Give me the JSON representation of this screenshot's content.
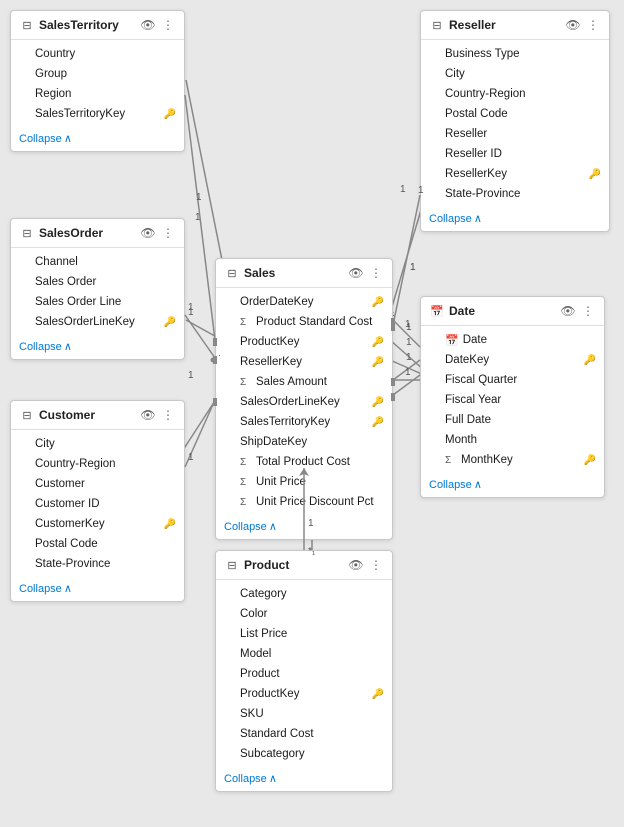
{
  "tables": {
    "salesTerritory": {
      "title": "SalesTerritory",
      "icon": "🗓",
      "fields": [
        {
          "name": "Country",
          "prefix": ""
        },
        {
          "name": "Group",
          "prefix": ""
        },
        {
          "name": "Region",
          "prefix": ""
        },
        {
          "name": "SalesTerritoryKey",
          "prefix": "",
          "key": true
        }
      ],
      "collapse": "Collapse"
    },
    "salesOrder": {
      "title": "SalesOrder",
      "icon": "🗓",
      "fields": [
        {
          "name": "Channel",
          "prefix": ""
        },
        {
          "name": "Sales Order",
          "prefix": ""
        },
        {
          "name": "Sales Order Line",
          "prefix": ""
        },
        {
          "name": "SalesOrderLineKey",
          "prefix": "",
          "key": true
        }
      ],
      "collapse": "Collapse"
    },
    "customer": {
      "title": "Customer",
      "icon": "🗓",
      "fields": [
        {
          "name": "City",
          "prefix": ""
        },
        {
          "name": "Country-Region",
          "prefix": ""
        },
        {
          "name": "Customer",
          "prefix": ""
        },
        {
          "name": "Customer ID",
          "prefix": ""
        },
        {
          "name": "CustomerKey",
          "prefix": "",
          "key": true
        },
        {
          "name": "Postal Code",
          "prefix": ""
        },
        {
          "name": "State-Province",
          "prefix": ""
        }
      ],
      "collapse": "Collapse"
    },
    "sales": {
      "title": "Sales",
      "icon": "🗓",
      "fields": [
        {
          "name": "OrderDateKey",
          "prefix": "",
          "key": true
        },
        {
          "name": "Product Standard Cost",
          "prefix": "Σ"
        },
        {
          "name": "ProductKey",
          "prefix": "",
          "key": true
        },
        {
          "name": "ResellerKey",
          "prefix": "",
          "key": true
        },
        {
          "name": "Sales Amount",
          "prefix": "Σ"
        },
        {
          "name": "SalesOrderLineKey",
          "prefix": "",
          "key": true
        },
        {
          "name": "SalesTerritoryKey",
          "prefix": "",
          "key": true
        },
        {
          "name": "ShipDateKey",
          "prefix": ""
        },
        {
          "name": "Total Product Cost",
          "prefix": "Σ"
        },
        {
          "name": "Unit Price",
          "prefix": "Σ"
        },
        {
          "name": "Unit Price Discount Pct",
          "prefix": "Σ"
        }
      ],
      "collapse": "Collapse"
    },
    "reseller": {
      "title": "Reseller",
      "icon": "🗓",
      "fields": [
        {
          "name": "Business Type",
          "prefix": ""
        },
        {
          "name": "City",
          "prefix": ""
        },
        {
          "name": "Country-Region",
          "prefix": ""
        },
        {
          "name": "Postal Code",
          "prefix": ""
        },
        {
          "name": "Reseller",
          "prefix": ""
        },
        {
          "name": "Reseller ID",
          "prefix": ""
        },
        {
          "name": "ResellerKey",
          "prefix": "",
          "key": true
        },
        {
          "name": "State-Province",
          "prefix": ""
        }
      ],
      "collapse": "Collapse"
    },
    "date": {
      "title": "Date",
      "icon": "📅",
      "fields": [
        {
          "name": "Date",
          "prefix": "📅"
        },
        {
          "name": "DateKey",
          "prefix": "",
          "key": true
        },
        {
          "name": "Fiscal Quarter",
          "prefix": ""
        },
        {
          "name": "Fiscal Year",
          "prefix": ""
        },
        {
          "name": "Full Date",
          "prefix": ""
        },
        {
          "name": "Month",
          "prefix": ""
        },
        {
          "name": "MonthKey",
          "prefix": "Σ",
          "key": true
        }
      ],
      "collapse": "Collapse"
    },
    "product": {
      "title": "Product",
      "icon": "🗓",
      "fields": [
        {
          "name": "Category",
          "prefix": ""
        },
        {
          "name": "Color",
          "prefix": ""
        },
        {
          "name": "List Price",
          "prefix": ""
        },
        {
          "name": "Model",
          "prefix": ""
        },
        {
          "name": "Product",
          "prefix": ""
        },
        {
          "name": "ProductKey",
          "prefix": "",
          "key": true
        },
        {
          "name": "SKU",
          "prefix": ""
        },
        {
          "name": "Standard Cost",
          "prefix": ""
        },
        {
          "name": "Subcategory",
          "prefix": ""
        }
      ],
      "collapse": "Collapse"
    }
  },
  "icons": {
    "eye": "👁",
    "more": "⋮",
    "key": "🔑",
    "collapse_arrow": "∧"
  }
}
